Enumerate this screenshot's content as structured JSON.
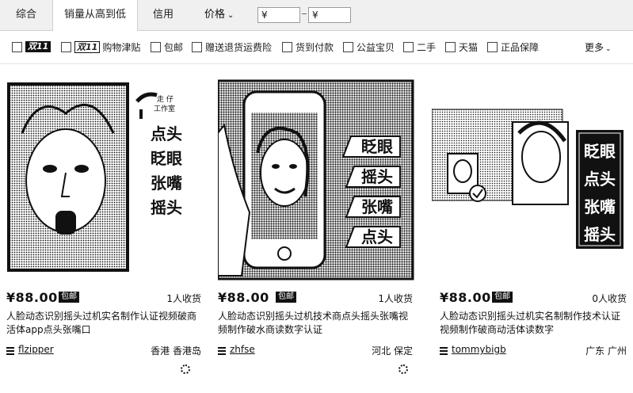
{
  "sortbar": {
    "tabs": [
      {
        "label": "综合",
        "active": false
      },
      {
        "label": "销量从高到低",
        "active": true
      },
      {
        "label": "信用",
        "active": false
      }
    ],
    "price_label": "价格",
    "price_from_placeholder": "¥",
    "price_to_placeholder": "¥"
  },
  "filters": {
    "double11_badge": "双11",
    "double11_shopping_badge": "双11",
    "double11_shopping_label": "购物津贴",
    "items": [
      "包邮",
      "赠送退货运费险",
      "货到付款",
      "公益宝贝",
      "二手",
      "天猫",
      "正品保障"
    ],
    "more_label": "更多"
  },
  "products": [
    {
      "price": "¥88.00",
      "baoyou": "包邮",
      "sold": "1人收货",
      "title": "人脸动态识别摇头过机实名制作认证视频破商活体app点头张嘴口",
      "shop": "flzipper",
      "location": "香港 香港岛",
      "image_words": [
        "点头",
        "眨眼",
        "张嘴",
        "摇头"
      ],
      "image_badge": "工作室"
    },
    {
      "price": "¥88.00",
      "baoyou": "包邮",
      "sold": "1人收货",
      "title": "人脸动态识别摇头过机技术商点头摇头张嘴视频制作破水商读数字认证",
      "shop": "zhfse",
      "location": "河北 保定",
      "image_words": [
        "眨眼",
        "摇头",
        "张嘴",
        "点头"
      ]
    },
    {
      "price": "¥88.00",
      "baoyou": "包邮",
      "sold": "0人收货",
      "title": "人脸动态识别摇头过机实名制制作技术认证视频制作破商动活体读数字",
      "shop": "tommybigb",
      "location": "广东 广州",
      "image_words": [
        "眨眼",
        "点头",
        "张嘴",
        "摇头"
      ]
    }
  ]
}
